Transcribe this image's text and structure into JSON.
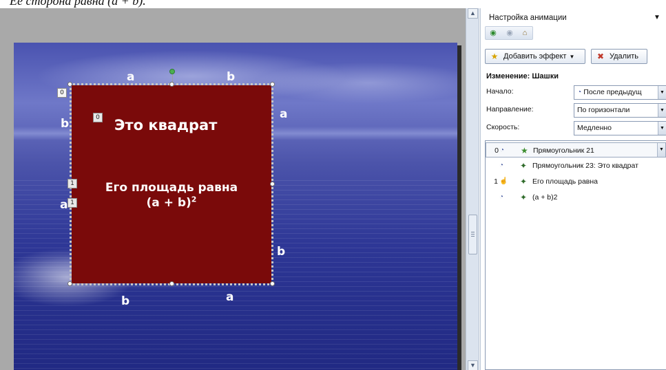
{
  "top_text": "Ее сторона равна (a + b).",
  "slide": {
    "square_title": "Это квадрат",
    "area_line1": "Его площадь равна",
    "area_formula_base": "(a + b)",
    "area_formula_exp": "2",
    "side_labels": {
      "top_a": "a",
      "top_b": "b",
      "left_b": "b",
      "left_a": "a",
      "right_a": "a",
      "right_b": "b",
      "bottom_b": "b",
      "bottom_a": "a"
    },
    "anim_tags": {
      "shape_tag": "0",
      "title_tag": "0",
      "area_tag_top": "1",
      "area_tag_bottom": "1"
    }
  },
  "task_pane": {
    "title": "Настройка анимации",
    "menu_icon": "▼",
    "nav_icons": [
      "back-icon",
      "forward-icon",
      "home-icon"
    ],
    "add_effect_label": "Добавить эффект",
    "remove_label": "Удалить",
    "section_title": "Изменение: Шашки",
    "fields": [
      {
        "label": "Начало:",
        "value": "После предыдущ"
      },
      {
        "label": "Направление:",
        "value": "По горизонтали"
      },
      {
        "label": "Скорость:",
        "value": "Медленно"
      }
    ],
    "animation_list": [
      {
        "num": "0",
        "trigger_icon": "clock-icon",
        "name": "Прямоугольник 21",
        "selected": true
      },
      {
        "num": "",
        "trigger_icon": "clock-icon",
        "name": "Прямоугольник 23: Это квадрат",
        "selected": false
      },
      {
        "num": "1",
        "trigger_icon": "mouse-click-icon",
        "name": "Его площадь равна",
        "selected": false
      },
      {
        "num": "",
        "trigger_icon": "clock-icon",
        "name": "(a + b)2",
        "selected": false
      }
    ]
  },
  "colors": {
    "square": "#7a0a0a",
    "canvas": "#a9a9a9",
    "slide_sky": "#4a53b0",
    "pane_border": "#8a9ab3"
  }
}
